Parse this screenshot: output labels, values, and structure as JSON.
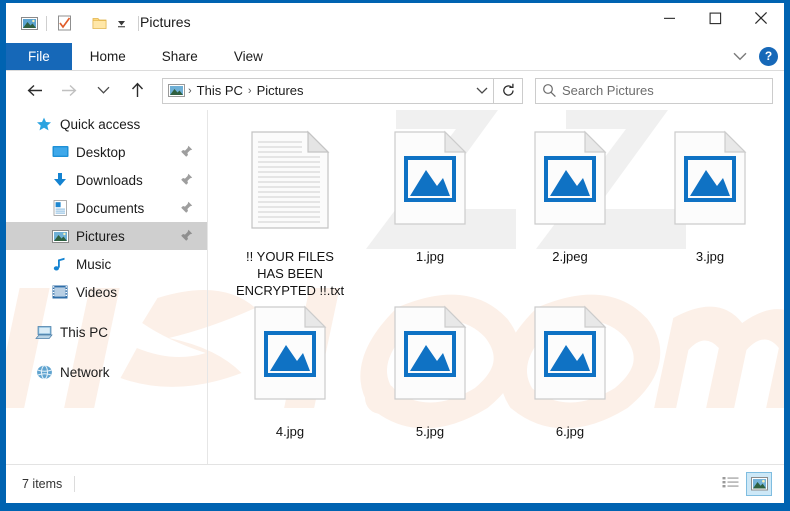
{
  "window": {
    "title": "Pictures",
    "border_color": "#0063b1",
    "accent_color": "#1668b8",
    "quick_access_icons": [
      "pictures-icon",
      "properties-icon",
      "new-folder-icon",
      "customize-dropdown-icon"
    ],
    "controls": {
      "minimize": "—",
      "maximize": "☐",
      "close": "✕"
    },
    "help_label": "?"
  },
  "ribbon": {
    "tabs": [
      {
        "label": "File",
        "selected": true
      },
      {
        "label": "Home",
        "selected": false
      },
      {
        "label": "Share",
        "selected": false
      },
      {
        "label": "View",
        "selected": false
      }
    ],
    "collapse_icon": "chevron-down-icon",
    "help_icon": "help-icon"
  },
  "nav": {
    "back": "back-arrow-icon",
    "forward": "forward-arrow-icon",
    "recent": "recent-locations-icon",
    "up": "up-arrow-icon",
    "breadcrumb": {
      "icon": "pictures-folder-icon",
      "items": [
        "This PC",
        "Pictures"
      ],
      "separator": "›"
    },
    "address_dropdown": "chevron-down-icon",
    "refresh": "refresh-icon"
  },
  "search": {
    "placeholder": "Search Pictures",
    "value": "",
    "icon": "search-icon"
  },
  "sidebar": {
    "groups": [
      {
        "header": {
          "label": "Quick access",
          "icon": "star-icon"
        },
        "items": [
          {
            "label": "Desktop",
            "icon": "desktop-icon",
            "pinned": true,
            "selected": false
          },
          {
            "label": "Downloads",
            "icon": "downloads-icon",
            "pinned": true,
            "selected": false
          },
          {
            "label": "Documents",
            "icon": "documents-icon",
            "pinned": true,
            "selected": false
          },
          {
            "label": "Pictures",
            "icon": "pictures-icon",
            "pinned": true,
            "selected": true
          },
          {
            "label": "Music",
            "icon": "music-icon",
            "pinned": false,
            "selected": false
          },
          {
            "label": "Videos",
            "icon": "videos-icon",
            "pinned": false,
            "selected": false
          }
        ]
      },
      {
        "header": null,
        "items": [
          {
            "label": "This PC",
            "icon": "this-pc-icon",
            "pinned": false,
            "selected": false
          }
        ]
      },
      {
        "header": null,
        "items": [
          {
            "label": "Network",
            "icon": "network-icon",
            "pinned": false,
            "selected": false
          }
        ]
      }
    ]
  },
  "files": [
    {
      "name": "!! YOUR FILES HAS BEEN ENCRYPTED !!.txt",
      "icon": "text-file-icon"
    },
    {
      "name": "1.jpg",
      "icon": "image-file-icon"
    },
    {
      "name": "2.jpeg",
      "icon": "image-file-icon"
    },
    {
      "name": "3.jpg",
      "icon": "image-file-icon"
    },
    {
      "name": "4.jpg",
      "icon": "image-file-icon"
    },
    {
      "name": "5.jpg",
      "icon": "image-file-icon"
    },
    {
      "name": "6.jpg",
      "icon": "image-file-icon"
    }
  ],
  "status": {
    "item_count": "7 items",
    "views": [
      {
        "icon": "details-view-icon",
        "active": false
      },
      {
        "icon": "large-icons-view-icon",
        "active": true
      }
    ]
  },
  "watermark": {
    "gray_text": "Z",
    "peach_text": "risk.com"
  }
}
